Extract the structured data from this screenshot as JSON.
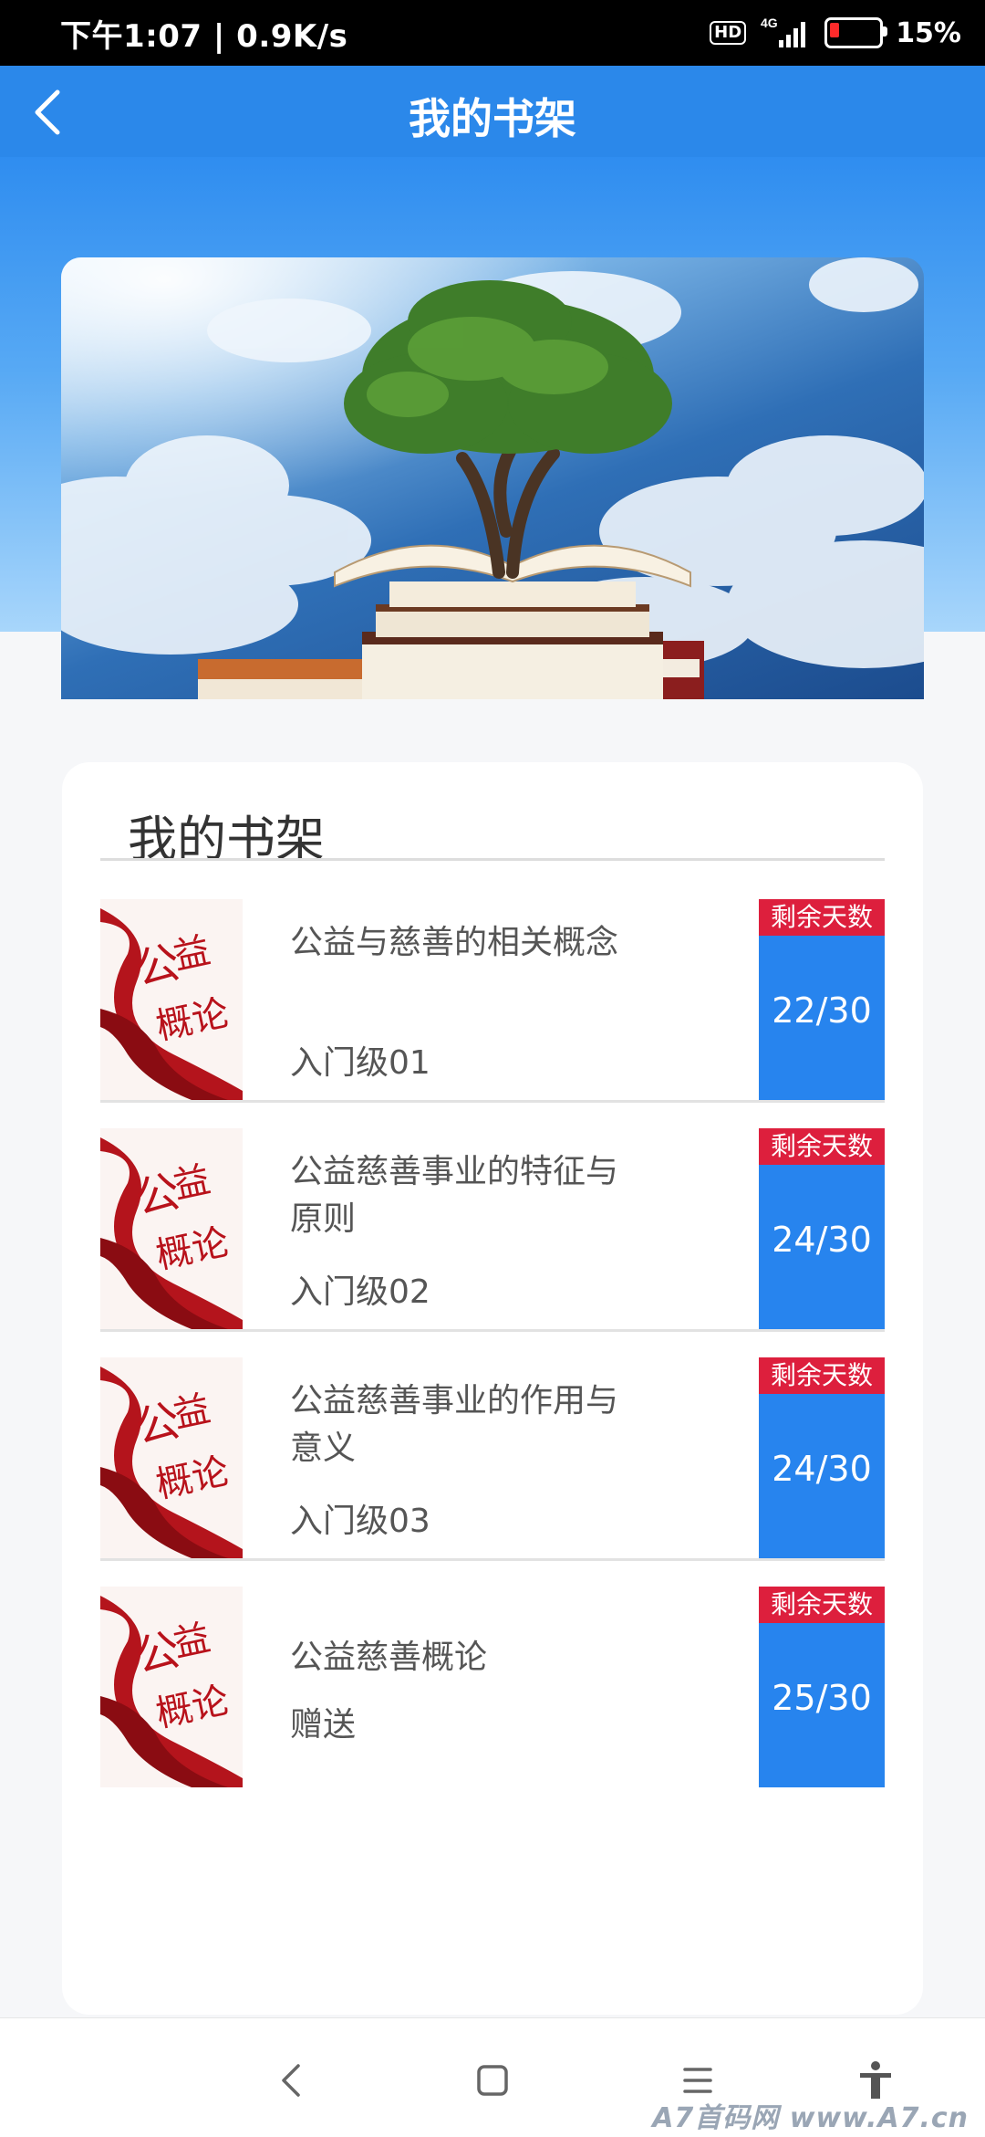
{
  "status_bar": {
    "time_speed": "下午1:07 | 0.9K/s",
    "hd": "HD",
    "network": "4G",
    "battery_level": 0.15,
    "battery_text": "15%"
  },
  "header": {
    "title": "我的书架"
  },
  "shelf": {
    "heading": "我的书架",
    "books": [
      {
        "title": "公益与慈善的相关概念",
        "level": "入门级01",
        "days_label": "剩余天数",
        "days": "22/30"
      },
      {
        "title": "公益慈善事业的特征与原则",
        "level": "入门级02",
        "days_label": "剩余天数",
        "days": "24/30"
      },
      {
        "title": "公益慈善事业的作用与意义",
        "level": "入门级03",
        "days_label": "剩余天数",
        "days": "24/30"
      },
      {
        "title": "公益慈善概论",
        "level": "赠送",
        "days_label": "剩余天数",
        "days": "25/30"
      }
    ]
  },
  "watermark": "A7首码网  www.A7.cn",
  "colors": {
    "brand_blue": "#2b88ea",
    "days_red": "#dd1f3d",
    "days_blue": "#2784ee"
  }
}
